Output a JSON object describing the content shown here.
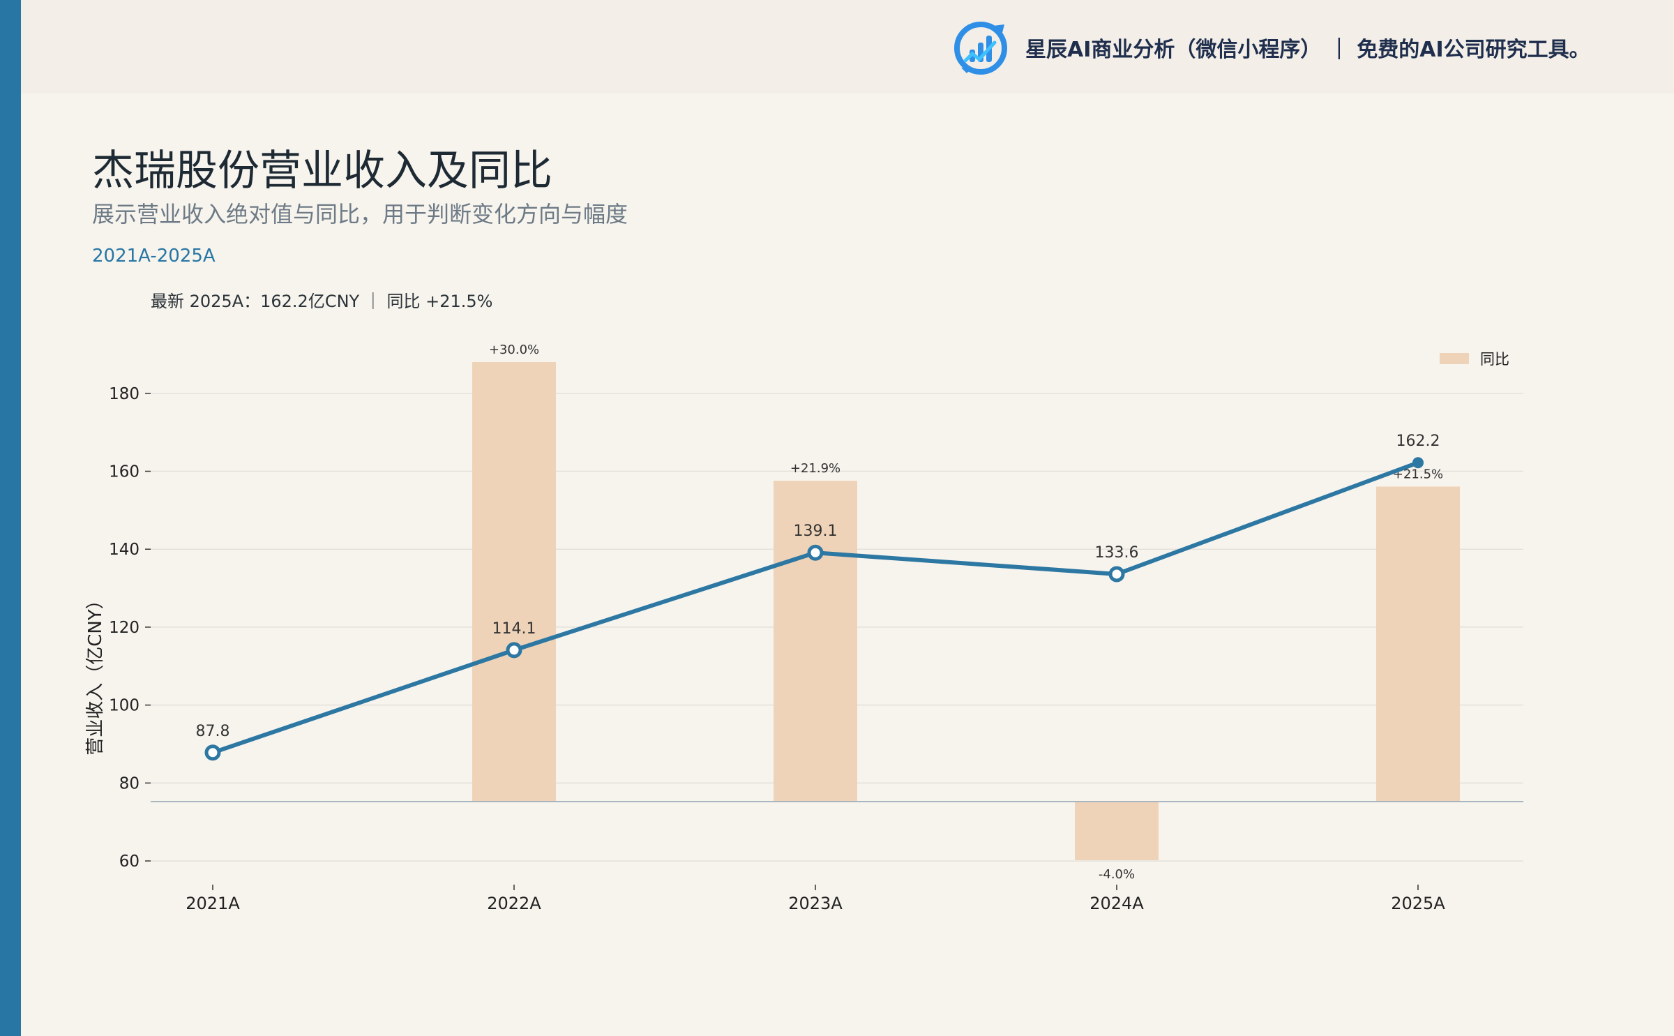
{
  "header": {
    "brand_text": "星辰AI商业分析（微信小程序） ｜ 免费的AI公司研究工具。"
  },
  "title": "杰瑞股份营业收入及同比",
  "subtitle": "展示营业收入绝对值与同比，用于判断变化方向与幅度",
  "range": "2021A-2025A",
  "latest": "最新 2025A：162.2亿CNY ｜ 同比 +21.5%",
  "colors": {
    "line": "#2d77a3",
    "bar": "#efd3b8",
    "accent": "#2776a4"
  },
  "chart_data": {
    "type": "bar+line",
    "categories": [
      "2021A",
      "2022A",
      "2023A",
      "2024A",
      "2025A"
    ],
    "ylabel": "营业收入（亿CNY）",
    "ylim": [
      55,
      195
    ],
    "yticks": [
      60,
      80,
      100,
      120,
      140,
      160,
      180
    ],
    "grid": true,
    "legend_position": "top-right",
    "series": [
      {
        "name": "同比",
        "type": "bar",
        "values": [
          null,
          30.0,
          21.9,
          -4.0,
          21.5
        ],
        "labels": [
          "",
          "+30.0%",
          "+21.9%",
          "-4.0%",
          "+21.5%"
        ]
      },
      {
        "type": "line",
        "values": [
          87.8,
          114.1,
          139.1,
          133.6,
          162.2
        ],
        "labels": [
          "87.8",
          "114.1",
          "139.1",
          "133.6",
          "162.2"
        ]
      }
    ]
  }
}
